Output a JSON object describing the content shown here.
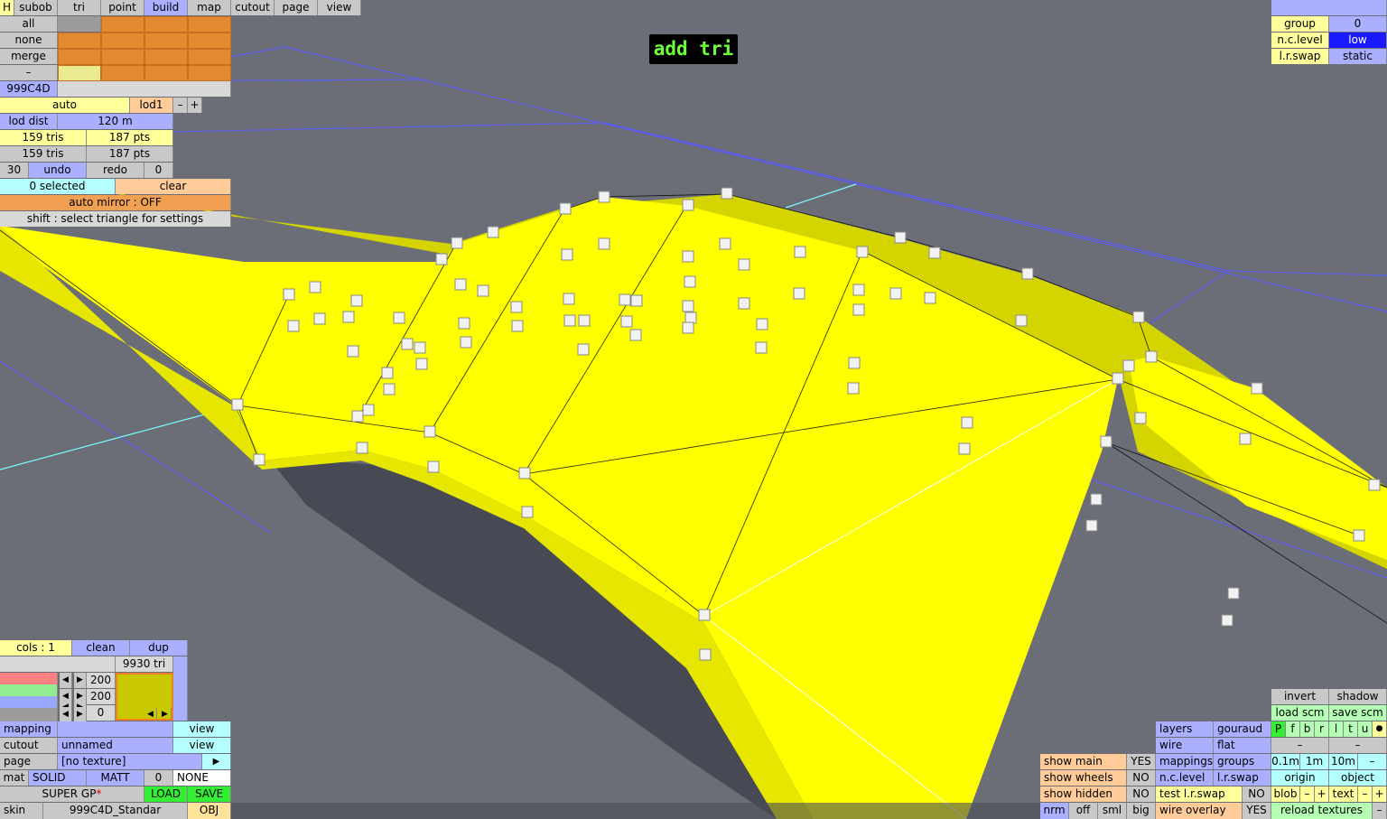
{
  "top_menu": {
    "h": "H",
    "tabs": [
      "subob",
      "tri",
      "point",
      "build",
      "map",
      "cutout",
      "page",
      "view"
    ],
    "active": "build"
  },
  "mode_label": "add tri",
  "left_panel": {
    "subob_buttons": [
      "all",
      "none",
      "merge",
      "–"
    ],
    "color_code": "999C4D",
    "lod_mode": "auto",
    "lod_name": "lod1",
    "lod_minus": "–",
    "lod_plus": "+",
    "lod_dist_label": "lod dist",
    "lod_dist_value": "120 m",
    "tris_1": "159 tris",
    "pts_1": "187 pts",
    "tris_2": "159 tris",
    "pts_2": "187 pts",
    "undo_count": "30",
    "undo": "undo",
    "redo": "redo",
    "redo_count": "0",
    "selected": "0 selected",
    "clear": "clear",
    "auto_mirror": "auto mirror : OFF",
    "hint": "shift : select triangle for settings"
  },
  "top_right": {
    "group_label": "group",
    "group_value": "0",
    "nclevel_label": "n.c.level",
    "nclevel_value": "low",
    "lrswap_label": "l.r.swap",
    "lrswap_value": "static"
  },
  "bottom_left": {
    "cols": "cols : 1",
    "clean": "clean",
    "dup": "dup",
    "tri_count": "9930 tri",
    "slider_values": [
      "200",
      "200",
      "0"
    ],
    "mapping_label": "mapping",
    "mapping_view": "view",
    "cutout_label": "cutout",
    "cutout_value": "unnamed",
    "cutout_view": "view",
    "page_label": "page",
    "page_value": "[no texture]",
    "page_arrow": "▶",
    "mat_label": "mat",
    "mat_solid": "SOLID",
    "mat_matt": "MATT",
    "mat_num": "0",
    "mat_none": "NONE",
    "super_gp": "SUPER GP",
    "super_gp_mark": "*",
    "load": "LOAD",
    "save": "SAVE",
    "skin_label": "skin",
    "skin_value": "999C4D_Standar",
    "obj": "OBJ",
    "swatch_color": "#c8c800"
  },
  "bottom_right": {
    "show_main": "show main",
    "show_main_v": "YES",
    "show_wheels": "show wheels",
    "show_wheels_v": "NO",
    "show_hidden": "show hidden",
    "show_hidden_v": "NO",
    "nrm": "nrm",
    "off": "off",
    "sml": "sml",
    "big": "big",
    "layers": "layers",
    "gouraud": "gouraud",
    "wire": "wire",
    "flat": "flat",
    "mappings": "mappings",
    "groups": "groups",
    "nclevel": "n.c.level",
    "lrswap": "l.r.swap",
    "test_lrswap": "test l.r.swap",
    "test_lrswap_v": "NO",
    "wire_overlay": "wire overlay",
    "wire_overlay_v": "YES",
    "invert": "invert",
    "shadow": "shadow",
    "load_scm": "load scm",
    "save_scm": "save scm",
    "flags": [
      "P",
      "f",
      "b",
      "r",
      "l",
      "t",
      "u",
      "●"
    ],
    "dash1": "–",
    "dash2": "–",
    "g01": "0.1m",
    "g1": "1m",
    "g10": "10m",
    "gminus": "–",
    "origin": "origin",
    "object": "object",
    "blob": "blob",
    "text": "text",
    "minus": "–",
    "plus": "+",
    "reload": "reload textures",
    "reload_minus": "–"
  },
  "colors": {
    "mesh": "#ffff00",
    "mesh_side": "#cfcf00",
    "background": "#6b6e76",
    "grid": "#5a5af0"
  }
}
